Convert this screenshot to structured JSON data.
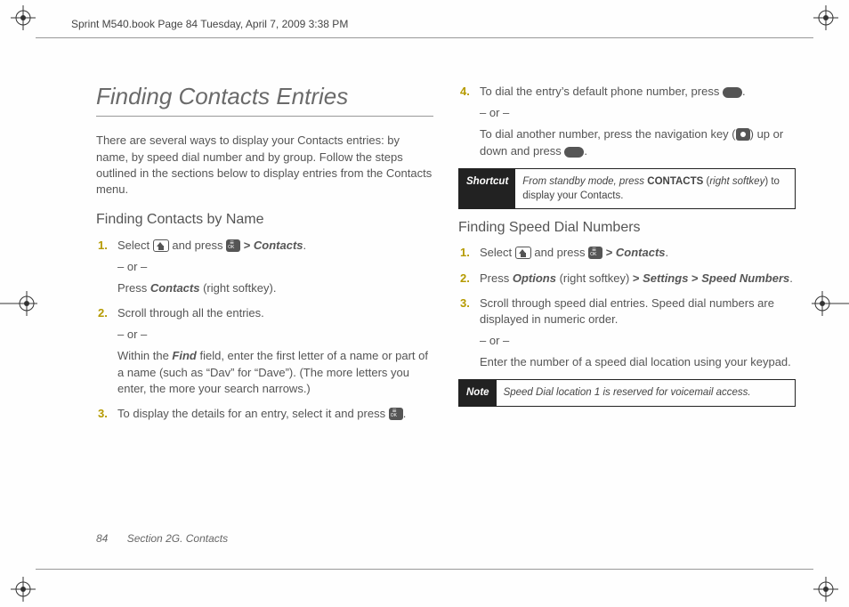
{
  "meta": {
    "header": "Sprint M540.book  Page 84  Tuesday, April 7, 2009  3:38 PM"
  },
  "title": "Finding Contacts Entries",
  "intro": "There are several ways to display your Contacts entries: by name, by speed dial number and by group. Follow the steps outlined in the sections below to display entries from the Contacts menu.",
  "byName": {
    "heading": "Finding Contacts by Name",
    "s1_a": "Select ",
    "s1_b": " and press ",
    "s1_c": " > ",
    "s1_d": "Contacts",
    "s1_e": ".",
    "or": "– or –",
    "s1_alt_a": "Press ",
    "s1_alt_b": "Contacts",
    "s1_alt_c": " (right softkey).",
    "s2": "Scroll through all the entries.",
    "s2_alt_a": "Within the ",
    "s2_alt_b": "Find",
    "s2_alt_c": " field, enter the first letter of a name or part of a name (such as “Dav” for “Dave”). (The more letters you enter, the more your search narrows.)",
    "s3_a": "To display the details for an entry, select it and press ",
    "s3_b": "."
  },
  "col2": {
    "s4_a": "To dial the entry’s default phone number, press ",
    "s4_b": ".",
    "or": "– or –",
    "s4_alt_a": "To dial another number, press the navigation key (",
    "s4_alt_b": ") up or down and press ",
    "s4_alt_c": "."
  },
  "shortcut": {
    "tag": "Shortcut",
    "body_a": "From standby mode, press ",
    "body_b": "CONTACTS",
    "body_c": " (",
    "body_d": "right softkey",
    "body_e": ") to display your Contacts."
  },
  "speed": {
    "heading": "Finding Speed Dial Numbers",
    "s1_a": "Select ",
    "s1_b": " and press ",
    "s1_c": " > ",
    "s1_d": "Contacts",
    "s1_e": ".",
    "s2_a": "Press ",
    "s2_b": "Options",
    "s2_c": " (right softkey) ",
    "s2_d": "> ",
    "s2_e": "Settings",
    "s2_f": " > ",
    "s2_g": "Speed Numbers",
    "s2_h": ".",
    "s3": "Scroll through speed dial entries. Speed dial numbers are displayed in numeric order.",
    "or": "– or –",
    "s3_alt": "Enter the number of a speed dial location using your keypad."
  },
  "note": {
    "tag": "Note",
    "body": "Speed Dial location 1 is reserved for voicemail access."
  },
  "footer": {
    "page": "84",
    "section": "Section 2G. Contacts"
  },
  "nums": {
    "n1": "1.",
    "n2": "2.",
    "n3": "3.",
    "n4": "4."
  }
}
